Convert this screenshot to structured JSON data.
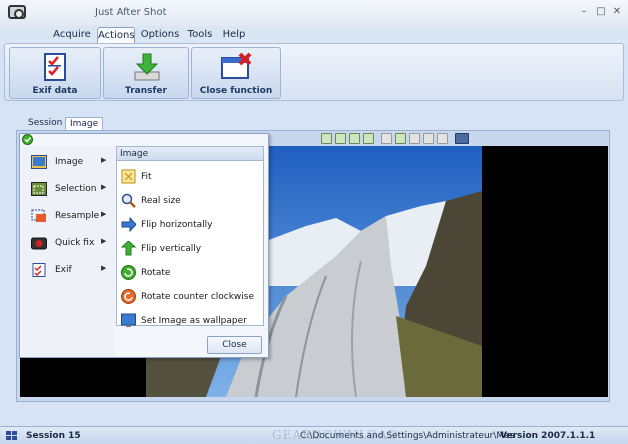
{
  "window": {
    "title": "Just After Shot"
  },
  "window_controls": {
    "minimize": "–",
    "maximize": "□",
    "close": "✕"
  },
  "menu": {
    "items": [
      "Acquire",
      "Actions",
      "Options",
      "Tools",
      "Help"
    ],
    "active": "Actions"
  },
  "ribbon": {
    "buttons": [
      {
        "label": "Exif data",
        "icon": "checklist-icon"
      },
      {
        "label": "Transfer",
        "icon": "download-arrow-icon"
      },
      {
        "label": "Close function",
        "icon": "close-window-icon"
      }
    ]
  },
  "tabs": {
    "items": [
      "Session",
      "Image"
    ],
    "active": "Image"
  },
  "popup": {
    "left_items": [
      {
        "label": "Image",
        "icon": "image-icon"
      },
      {
        "label": "Selection",
        "icon": "selection-icon"
      },
      {
        "label": "Resample",
        "icon": "resample-icon"
      },
      {
        "label": "Quick fix",
        "icon": "quick-fix-icon"
      },
      {
        "label": "Exif",
        "icon": "exif-icon"
      }
    ],
    "submenu_title": "Image",
    "submenu_items": [
      {
        "label": "Fit",
        "icon": "fit-icon"
      },
      {
        "label": "Real size",
        "icon": "magnifier-icon"
      },
      {
        "label": "Flip horizontally",
        "icon": "flip-horizontal-icon"
      },
      {
        "label": "Flip vertically",
        "icon": "flip-vertical-icon"
      },
      {
        "label": "Rotate",
        "icon": "rotate-icon"
      },
      {
        "label": "Rotate counter clockwise",
        "icon": "rotate-ccw-icon"
      },
      {
        "label": "Set Image as wallpaper",
        "icon": "wallpaper-icon"
      }
    ],
    "close_label": "Close"
  },
  "status": {
    "session": "Session 15",
    "path": "C:\\Documents and Settings\\Administrateur\\Mes",
    "version": "Version 2007.1.1.1"
  },
  "watermark": "GEARDOWNLOAD",
  "colors": {
    "accent": "#1f3a66",
    "panel": "#c7d7ee",
    "viewer_bg": "#000000"
  }
}
